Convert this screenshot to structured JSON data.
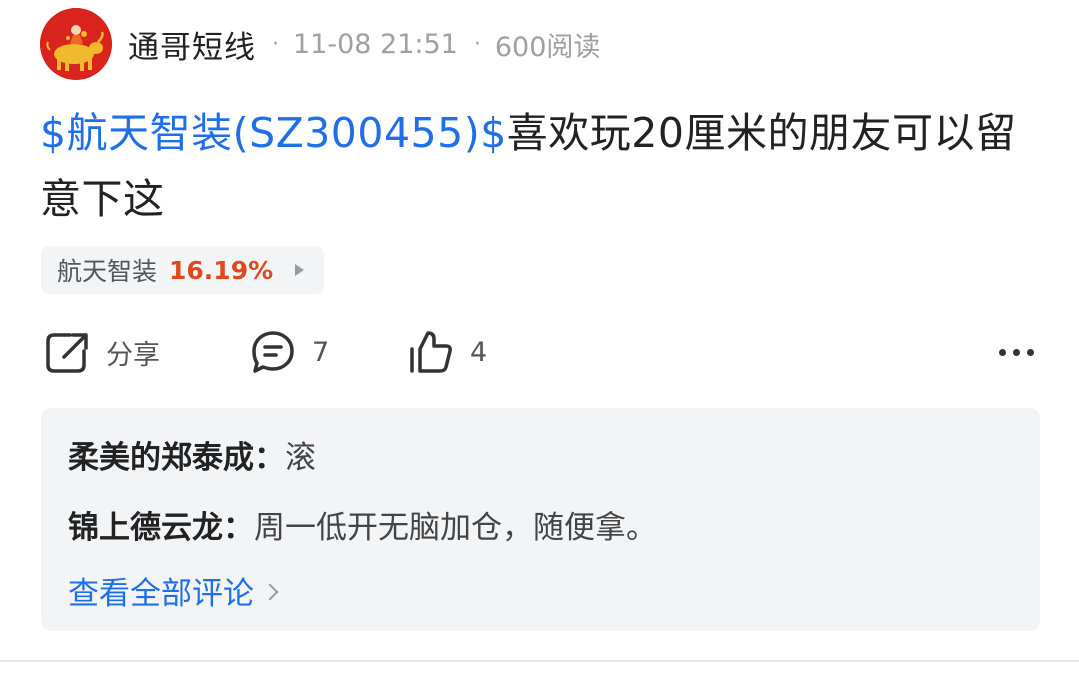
{
  "post": {
    "author": "通哥短线",
    "separator": "·",
    "timestamp": "11-08 21:51",
    "views": "600阅读",
    "stock_tag": "$航天智装(SZ300455)$",
    "body": "喜欢玩20厘米的朋友可以留意下这"
  },
  "stock_chip": {
    "name": "航天智装",
    "change": "16.19%",
    "change_color": "#e0481e"
  },
  "actions": {
    "share_label": "分享",
    "comment_count": "7",
    "like_count": "4"
  },
  "comments": [
    {
      "author": "柔美的郑泰成：",
      "text": "滚"
    },
    {
      "author": "锦上德云龙：",
      "text": "周一低开无脑加仓，随便拿。"
    }
  ],
  "view_all_label": "查看全部评论",
  "colors": {
    "link": "#1f6fe6",
    "avatar_bg": "#d8241c"
  },
  "icons": {
    "share": "share-icon",
    "comment": "comment-icon",
    "like": "thumbs-up-icon",
    "more": "more-icon"
  }
}
